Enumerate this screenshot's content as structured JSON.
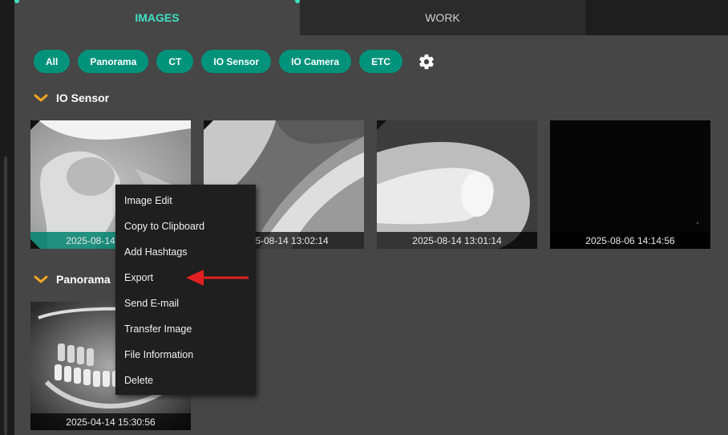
{
  "tabs": [
    {
      "label": "IMAGES",
      "active": true
    },
    {
      "label": "WORK",
      "active": false
    }
  ],
  "filters": [
    "All",
    "Panorama",
    "CT",
    "IO Sensor",
    "IO Camera",
    "ETC"
  ],
  "settings_icon": "gear-icon",
  "sections": {
    "io_sensor": {
      "title": "IO Sensor",
      "images": [
        {
          "timestamp": "2025-08-14 13:02:14",
          "selected": true
        },
        {
          "timestamp": "2025-08-14 13:02:14",
          "selected": false
        },
        {
          "timestamp": "2025-08-14 13:01:14",
          "selected": false
        },
        {
          "timestamp": "2025-08-06 14:14:56",
          "selected": false
        }
      ]
    },
    "panorama": {
      "title": "Panorama",
      "images": [
        {
          "timestamp": "2025-04-14 15:30:56",
          "selected": false
        }
      ]
    }
  },
  "context_menu": {
    "items": [
      "Image Edit",
      "Copy to Clipboard",
      "Add Hashtags",
      "Export",
      "Send E-mail",
      "Transfer Image",
      "File Information",
      "Delete"
    ],
    "highlighted_item": "Export"
  },
  "colors": {
    "accent": "#3fe0c3",
    "chip": "#00937c",
    "chevron": "#f5a623",
    "annotation_arrow": "#e02020",
    "panel": "#464646"
  }
}
